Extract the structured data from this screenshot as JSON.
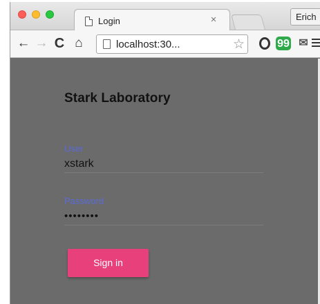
{
  "browser": {
    "tab": {
      "title": "Login",
      "close_glyph": "×"
    },
    "profile_label": "Erich",
    "toolbar": {
      "back_icon": "←",
      "forward_icon": "→",
      "reload_icon": "C",
      "home_icon": "⌂",
      "address": "localhost:30...",
      "star_icon": "☆",
      "quote_ext_glyph": "99",
      "mail_ext_glyph": "✉"
    }
  },
  "page": {
    "title": "Stark Laboratory",
    "user": {
      "label": "User",
      "value": "xstark"
    },
    "password": {
      "label": "Password",
      "value": "••••••••"
    },
    "signin_label": "Sign in"
  },
  "colors": {
    "overlay_bg": "#6b6b6b",
    "accent_label": "#5a6bd6",
    "signin_button": "#e8407a"
  }
}
